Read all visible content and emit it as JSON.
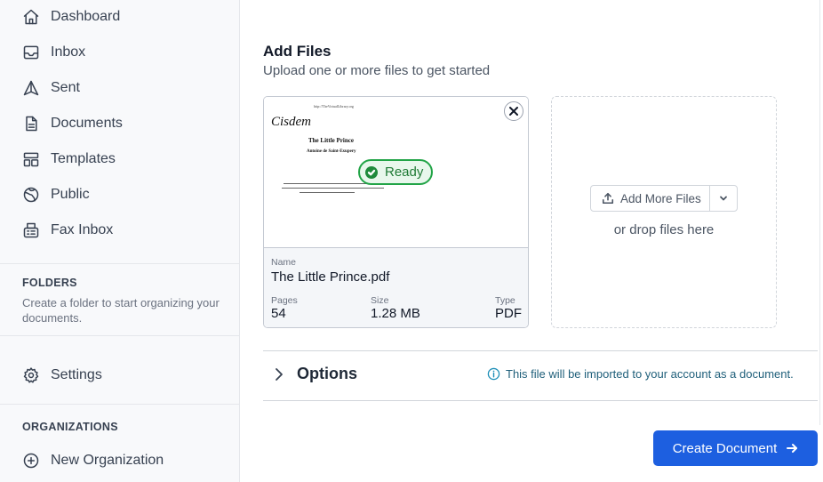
{
  "sidebar": {
    "nav": [
      {
        "label": "Dashboard",
        "icon": "home-icon"
      },
      {
        "label": "Inbox",
        "icon": "inbox-icon"
      },
      {
        "label": "Sent",
        "icon": "send-icon"
      },
      {
        "label": "Documents",
        "icon": "document-icon"
      },
      {
        "label": "Templates",
        "icon": "templates-icon"
      },
      {
        "label": "Public",
        "icon": "globe-icon"
      },
      {
        "label": "Fax Inbox",
        "icon": "fax-icon"
      }
    ],
    "folders": {
      "title": "FOLDERS",
      "description": "Create a folder to start organizing your documents."
    },
    "settings": {
      "label": "Settings",
      "icon": "gear-icon"
    },
    "organizations": {
      "title": "ORGANIZATIONS",
      "new_label": "New Organization",
      "icon": "plus-circle-icon"
    }
  },
  "main": {
    "title": "Add Files",
    "subtitle": "Upload one or more files to get started",
    "file": {
      "status": "Ready",
      "name_label": "Name",
      "name": "The Little Prince.pdf",
      "pages_label": "Pages",
      "pages": "54",
      "size_label": "Size",
      "size": "1.28 MB",
      "type_label": "Type",
      "type": "PDF",
      "preview": {
        "url": "http://TheVirtualLibrary.org",
        "logo": "Cisdem",
        "title": "The Little Prince",
        "author": "Antoine de Saint-Exupery"
      }
    },
    "drop": {
      "add_more_label": "Add More Files",
      "drop_text": "or drop files here"
    },
    "options": {
      "label": "Options",
      "notice": "This file will be imported to your account as a document."
    },
    "create_button": "Create Document"
  },
  "colors": {
    "primary": "#1d5fe0",
    "ready_green": "#22a447",
    "sidebar_bg": "#f8f9fb"
  }
}
